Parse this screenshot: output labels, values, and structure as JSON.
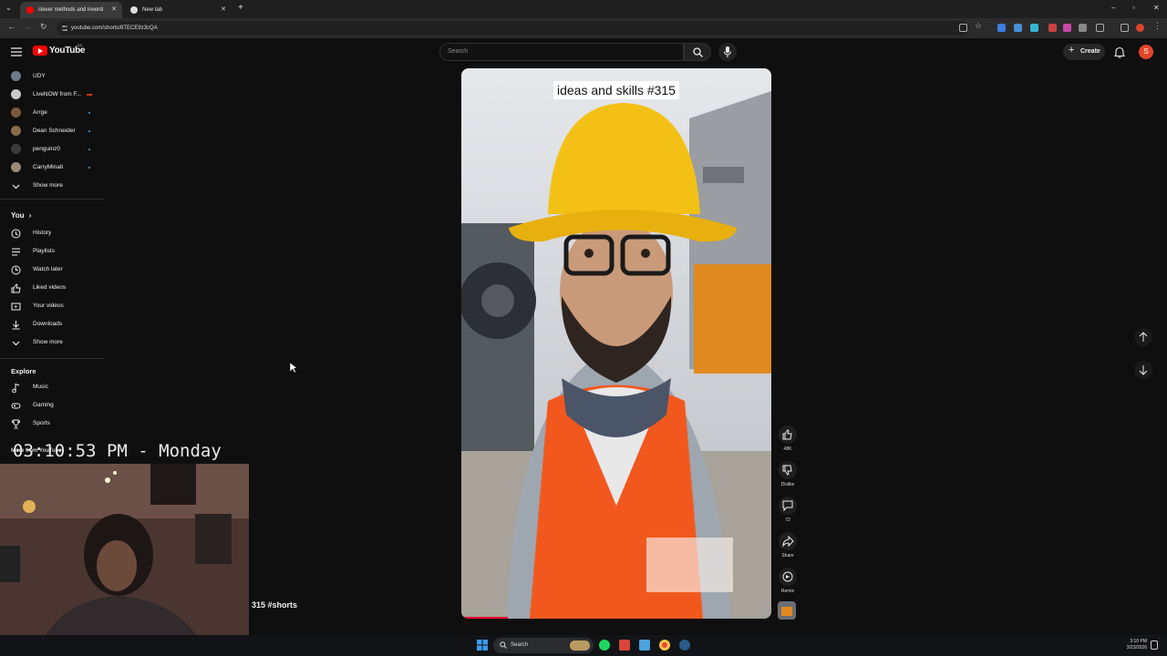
{
  "browser": {
    "tabs": [
      {
        "title": "clever methods and inventi",
        "active": true
      },
      {
        "title": "New tab",
        "active": false
      }
    ],
    "url": "youtube.com/shorts/8TECE9z3cQA"
  },
  "youtube": {
    "logo": "YouTube",
    "logo_sup": "BD",
    "search_placeholder": "Search",
    "create_label": "Create",
    "avatar_letter": "S"
  },
  "sidebar": {
    "subscriptions": [
      {
        "label": "UDY",
        "color": "#6d7a8a",
        "live": false,
        "dot": false
      },
      {
        "label": "LiveNOW from F...",
        "color": "#c9c9c9",
        "live": true,
        "dot": false
      },
      {
        "label": "Arrge",
        "color": "#7a5a3c",
        "live": false,
        "dot": true
      },
      {
        "label": "Dean Schneider",
        "color": "#8a6b4a",
        "live": false,
        "dot": true
      },
      {
        "label": "penguinz0",
        "color": "#3b3b3b",
        "live": false,
        "dot": true
      },
      {
        "label": "CarryMinati",
        "color": "#9b8b7b",
        "live": false,
        "dot": true
      }
    ],
    "show_more_1": "Show more",
    "you_heading": "You",
    "you_items": [
      {
        "label": "History",
        "icon": "history-icon"
      },
      {
        "label": "Playlists",
        "icon": "playlists-icon"
      },
      {
        "label": "Watch later",
        "icon": "clock-icon"
      },
      {
        "label": "Liked videos",
        "icon": "thumbs-up-icon"
      },
      {
        "label": "Your videos",
        "icon": "video-icon"
      },
      {
        "label": "Downloads",
        "icon": "download-icon"
      }
    ],
    "show_more_2": "Show more",
    "explore_heading": "Explore",
    "explore_items": [
      {
        "label": "Music",
        "icon": "music-note-icon"
      },
      {
        "label": "Gaming",
        "icon": "gamepad-icon"
      },
      {
        "label": "Sports",
        "icon": "trophy-icon"
      }
    ],
    "more_from": "More from YouTube"
  },
  "short": {
    "caption": "ideas and skills #315",
    "title": "315 #shorts",
    "progress": 0.15,
    "actions": [
      {
        "name": "like-button",
        "icon": "thumbs-up-icon",
        "count": "48K"
      },
      {
        "name": "dislike-button",
        "icon": "thumbs-down-icon",
        "count": "Dislike"
      },
      {
        "name": "comments-button",
        "icon": "comment-icon",
        "count": "72"
      },
      {
        "name": "share-button",
        "icon": "share-icon",
        "count": "Share"
      },
      {
        "name": "remix-button",
        "icon": "remix-icon",
        "count": "Remix"
      }
    ]
  },
  "overlay": {
    "clock": "03:10:53 PM - Monday"
  },
  "taskbar": {
    "search_label": "Search",
    "time": "3:10 PM",
    "date": "3/23/2026"
  }
}
